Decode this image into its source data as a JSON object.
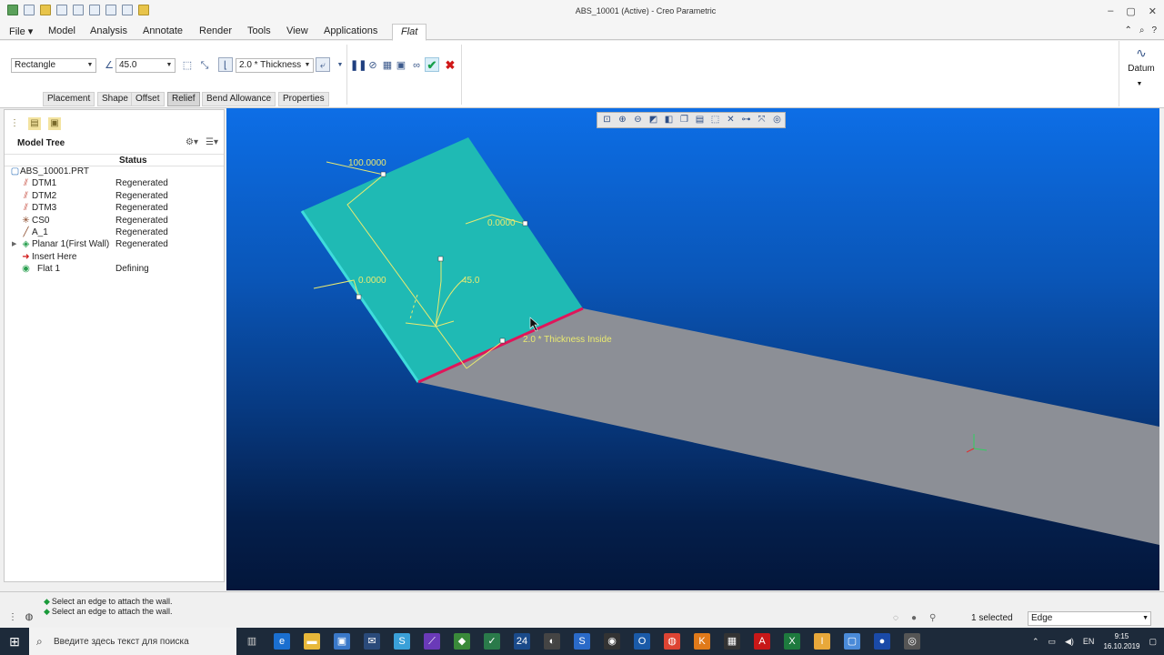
{
  "window": {
    "title": "ABS_10001 (Active) - Creo Parametric"
  },
  "menu": {
    "tabs": [
      "File",
      "Model",
      "Analysis",
      "Annotate",
      "Render",
      "Tools",
      "View",
      "Applications",
      "Flat"
    ],
    "active": "Flat"
  },
  "dashboard": {
    "relief_type": "Rectangle",
    "angle_value": "45.0",
    "thickness_value": "2.0 * Thickness",
    "subtabs": [
      "Placement",
      "Shape",
      "Offset",
      "Relief",
      "Bend Allowance",
      "Properties"
    ],
    "pressed_subtab": "Relief",
    "datum_label": "Datum"
  },
  "model_tree": {
    "title": "Model Tree",
    "status_header": "Status",
    "root": "ABS_10001.PRT",
    "rows": [
      {
        "name": "DTM1",
        "status": "Regenerated",
        "icon": "datum-plane-icon"
      },
      {
        "name": "DTM2",
        "status": "Regenerated",
        "icon": "datum-plane-icon"
      },
      {
        "name": "DTM3",
        "status": "Regenerated",
        "icon": "datum-plane-icon"
      },
      {
        "name": "CS0",
        "status": "Regenerated",
        "icon": "coordinate-system-icon"
      },
      {
        "name": "A_1",
        "status": "Regenerated",
        "icon": "datum-axis-icon"
      },
      {
        "name": "Planar 1(First Wall)",
        "status": "Regenerated",
        "icon": "planar-wall-icon"
      },
      {
        "name": "Insert Here",
        "status": "",
        "icon": "insert-here-arrow-icon"
      },
      {
        "name": "Flat 1",
        "status": "Defining",
        "icon": "flat-wall-icon"
      }
    ]
  },
  "viewport": {
    "dimensions": {
      "width": "100.0000",
      "offset_top": "0.0000",
      "offset_side": "0.0000",
      "angle": "45.0",
      "radius": "2.0 * Thickness Inside"
    }
  },
  "status": {
    "messages": [
      "Select an edge to attach the wall.",
      "Select an edge to attach the wall."
    ],
    "selection_count": "1 selected",
    "selection_filter": "Edge"
  },
  "taskbar": {
    "search_placeholder": "Введите здесь текст для поиска",
    "language": "EN",
    "time": "9:15",
    "date": "16.10.2019",
    "apps_count_badge": "24"
  },
  "colors": {
    "wall_face": "#1fbab4",
    "base_face": "#8c8f96",
    "attach_edge": "#e0155a",
    "dimension": "#eaea70",
    "confirm": "#18a04a",
    "cancel": "#d01818"
  }
}
